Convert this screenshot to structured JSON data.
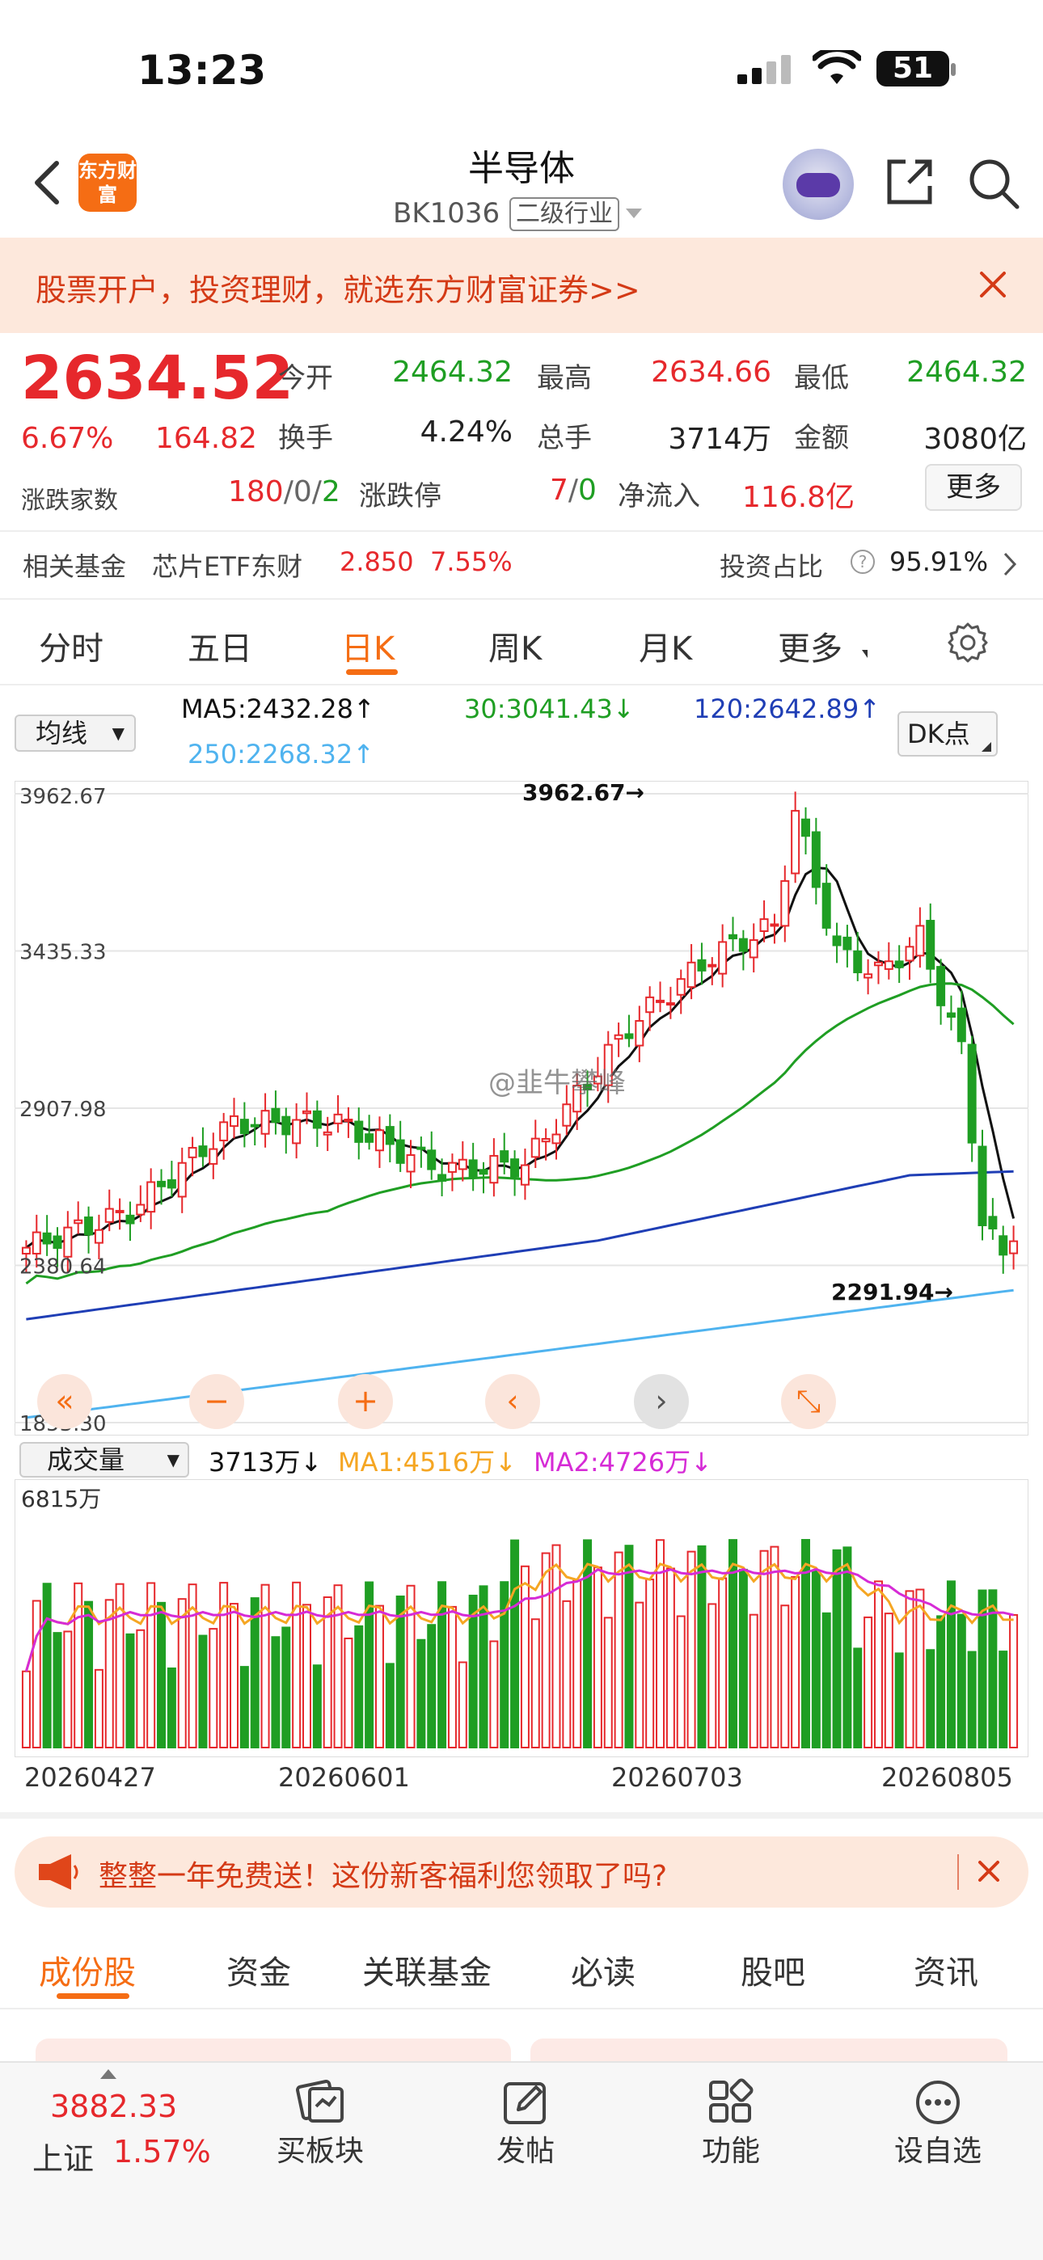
{
  "status_bar": {
    "time": "13:23",
    "battery": "51"
  },
  "header": {
    "app_logo": "东方财富",
    "title": "半导体",
    "code": "BK1036",
    "tag": "二级行业"
  },
  "promo": {
    "text": "股票开户，投资理财，就选东方财富证券>>"
  },
  "quote": {
    "price": "2634.52",
    "change_pct": "6.67%",
    "change_abs": "164.82",
    "breadth_label": "涨跌家数",
    "breadth_up": "180",
    "breadth_sep1": "/0/",
    "breadth_down": "2",
    "fields": [
      {
        "label": "今开",
        "value": "2464.32",
        "color": "#1f9e23"
      },
      {
        "label": "最高",
        "value": "2634.66",
        "color": "#e6282c"
      },
      {
        "label": "最低",
        "value": "2464.32",
        "color": "#1f9e23"
      },
      {
        "label": "换手",
        "value": "4.24%",
        "color": "#222222"
      },
      {
        "label": "总手",
        "value": "3714万",
        "color": "#222222"
      },
      {
        "label": "金额",
        "value": "3080亿",
        "color": "#222222"
      }
    ],
    "limit_label": "涨跌停",
    "limit_up": "7",
    "limit_sep": "/",
    "limit_down": "0",
    "inflow_label": "净流入",
    "inflow_value": "116.8亿",
    "more": "更多"
  },
  "fund": {
    "label": "相关基金",
    "name": "芯片ETF东财",
    "price": "2.850",
    "pct": "7.55%",
    "inv_label": "投资占比",
    "inv_value": "95.91%"
  },
  "period_tabs": [
    "分时",
    "五日",
    "日K",
    "周K",
    "月K",
    "更多"
  ],
  "period_active": "日K",
  "indicators": {
    "select": "均线",
    "ma5": "MA5:2432.28",
    "ma30": "30:3041.43",
    "ma120": "120:2642.89",
    "ma250": "250:2268.32",
    "dk": "DK点"
  },
  "chart_data": {
    "type": "candlestick",
    "y_labels": [
      "3962.67",
      "3435.33",
      "2907.98",
      "2380.64",
      "1853.30"
    ],
    "ylim": [
      1853.3,
      3962.67
    ],
    "high_annotation": "3962.67",
    "low_annotation": "2291.94",
    "watermark": "@韭牛攀峰",
    "x_labels": [
      "20260427",
      "20260601",
      "20260703",
      "20260805"
    ],
    "volume": {
      "select": "成交量",
      "current": "3713万",
      "ma1": "MA1:4516万",
      "ma2": "MA2:4726万",
      "max_label": "6815万",
      "max": 6815
    },
    "colors": {
      "up": "#e6282c",
      "down": "#1f9e23",
      "ma5": "#111111",
      "ma30": "#1f9e23",
      "ma120": "#1f3eb5",
      "ma250": "#4fb3ef",
      "vma1": "#f5a623",
      "vma2": "#d62bd6"
    }
  },
  "chart_nav": [
    "«",
    "−",
    "+",
    "‹",
    "›",
    "⤡"
  ],
  "ad": {
    "text": "整整一年免费送！这份新客福利您领取了吗?"
  },
  "section_tabs": [
    "成份股",
    "资金",
    "关联基金",
    "必读",
    "股吧",
    "资讯"
  ],
  "section_active": "成份股",
  "bottom_bar": {
    "index_value": "3882.33",
    "index_name": "上证",
    "index_pct": "1.57%",
    "items": [
      {
        "label": "买板块",
        "icon": "buy-sector-icon"
      },
      {
        "label": "发帖",
        "icon": "post-icon"
      },
      {
        "label": "功能",
        "icon": "apps-icon"
      },
      {
        "label": "设自选",
        "icon": "watchlist-icon"
      }
    ]
  }
}
